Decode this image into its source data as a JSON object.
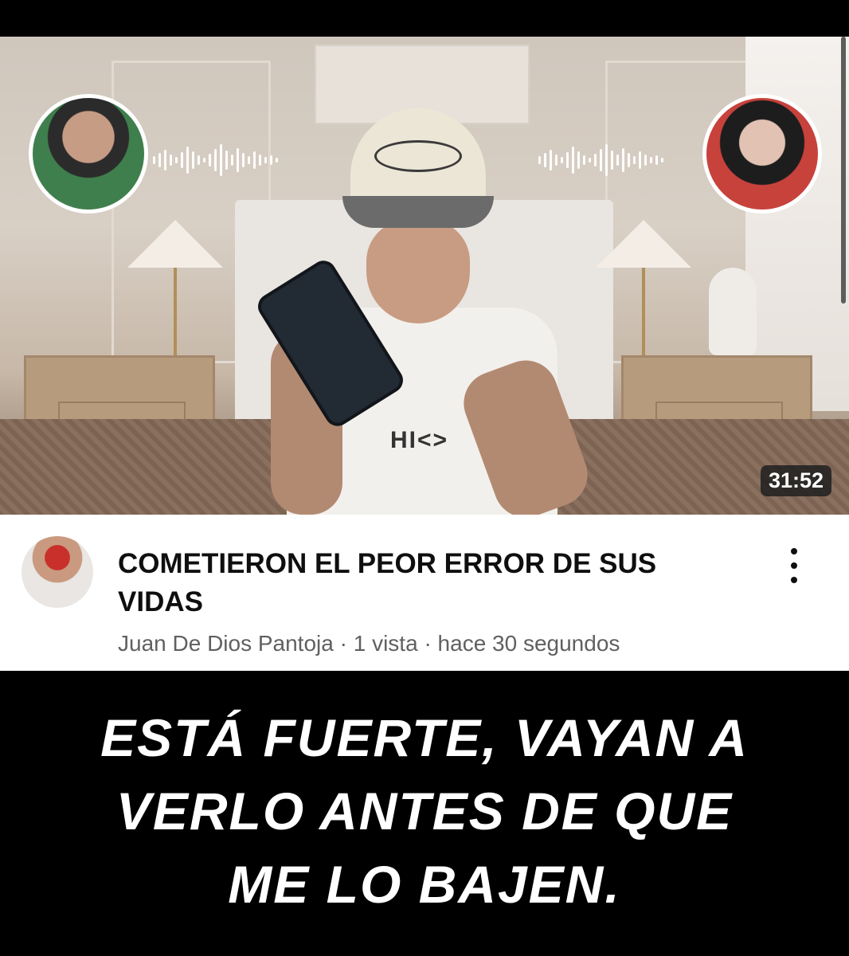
{
  "video": {
    "duration": "31:52",
    "title": "COMETIERON EL PEOR ERROR DE SUS VIDAS",
    "channel": "Juan De Dios Pantoja",
    "views": "1 vista",
    "posted": "hace 30 segundos",
    "separator": "·",
    "thumbnail_shirt_text": "HI<>"
  },
  "caption": {
    "line1": "ESTÁ FUERTE, VAYAN A",
    "line2": "VERLO ANTES DE QUE",
    "line3": "ME LO BAJEN."
  },
  "icons": {
    "menu": "more-vert-icon",
    "waveform": "audio-waveform-icon"
  },
  "colors": {
    "background": "#000000",
    "title_text": "#0f0f0f",
    "meta_text": "#606060",
    "caption_text": "#ffffff"
  }
}
